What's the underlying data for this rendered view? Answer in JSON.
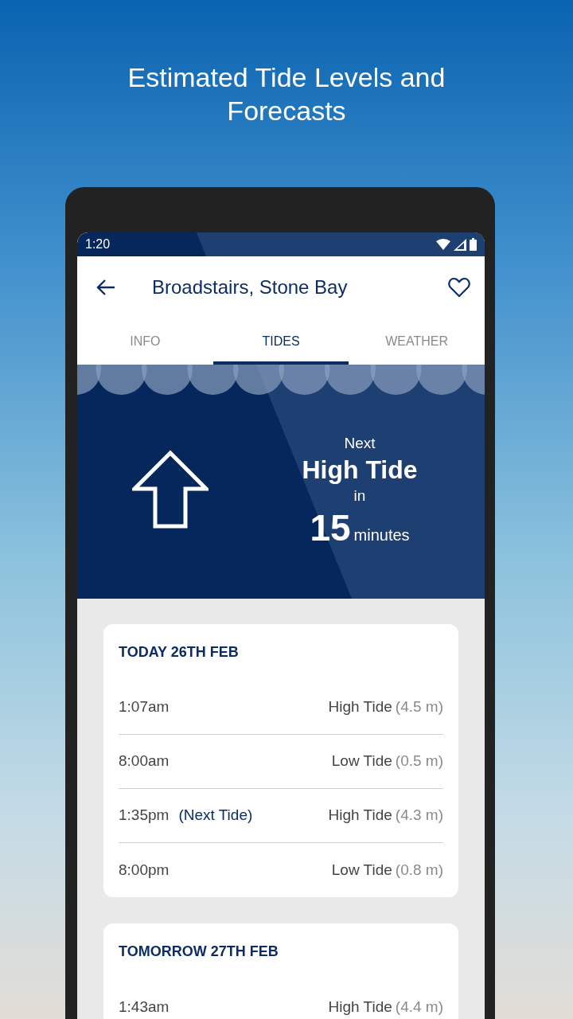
{
  "headline": "Estimated Tide Levels and Forecasts",
  "status_bar": {
    "time": "1:20"
  },
  "app_bar": {
    "title": "Broadstairs, Stone Bay",
    "favorite": false
  },
  "tabs": [
    {
      "label": "INFO",
      "selected": false
    },
    {
      "label": "TIDES",
      "selected": true
    },
    {
      "label": "WEATHER",
      "selected": false
    }
  ],
  "next_tide": {
    "prefix": "Next",
    "tide": "High Tide",
    "joiner": "in",
    "count": "15",
    "unit": "minutes",
    "rising": true
  },
  "days": [
    {
      "title": "TODAY 26TH FEB",
      "tides": [
        {
          "time": "1:07am",
          "type": "High Tide",
          "height": "(4.5 m)"
        },
        {
          "time": "8:00am",
          "type": "Low Tide",
          "height": "(0.5 m)"
        },
        {
          "time": "1:35pm",
          "note": "(Next Tide)",
          "type": "High Tide",
          "height": "(4.3 m)"
        },
        {
          "time": "8:00pm",
          "type": "Low Tide",
          "height": "(0.8 m)"
        }
      ]
    },
    {
      "title": "TOMORROW 27TH FEB",
      "tides": [
        {
          "time": "1:43am",
          "type": "High Tide",
          "height": "(4.4 m)"
        }
      ]
    }
  ]
}
